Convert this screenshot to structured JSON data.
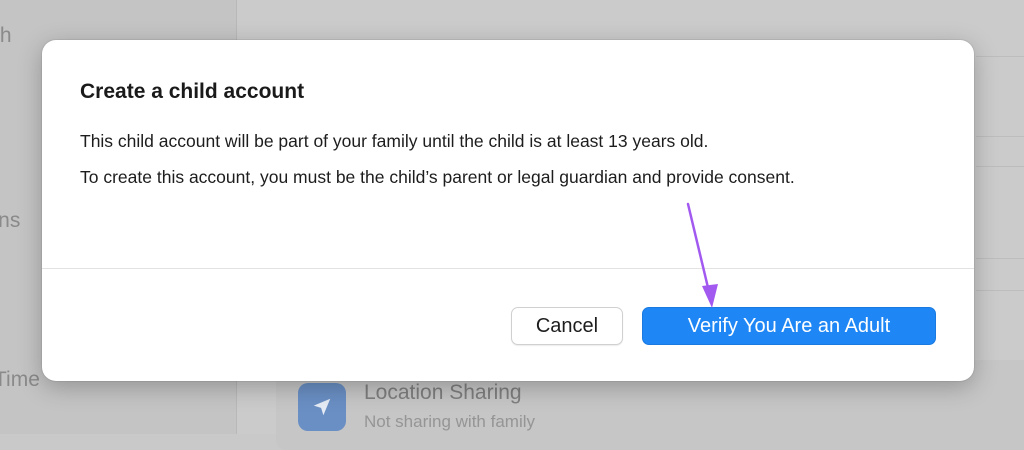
{
  "background": {
    "sidebar_fragments": [
      "th",
      "tions",
      "Time"
    ],
    "location_sharing": {
      "title": "Location Sharing",
      "subtitle": "Not sharing with family",
      "icon": "location-arrow-icon"
    }
  },
  "dialog": {
    "title": "Create a child account",
    "paragraph1": "This child account will be part of your family until the child is at least 13 years old.",
    "paragraph2": "To create this account, you must be the child’s parent or legal guardian and provide consent.",
    "cancel_label": "Cancel",
    "verify_label": "Verify You Are an Adult"
  },
  "colors": {
    "accent": "#1f87f5",
    "annotation_arrow": "#a259f0"
  }
}
